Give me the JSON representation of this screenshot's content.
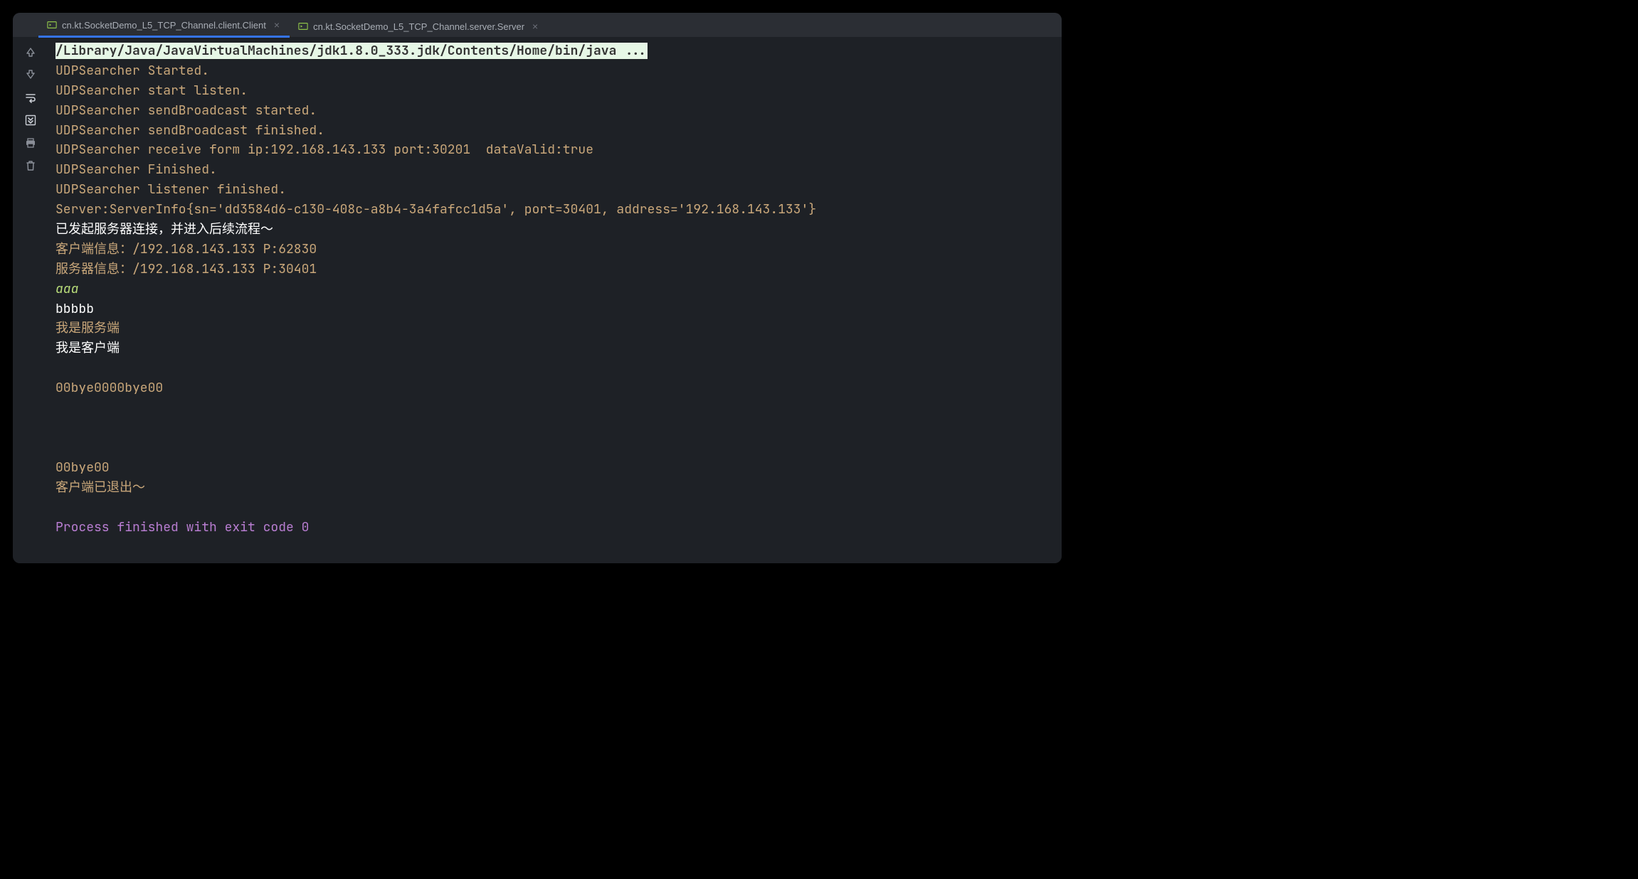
{
  "tabs": [
    {
      "label": "cn.kt.SocketDemo_L5_TCP_Channel.client.Client",
      "active": true
    },
    {
      "label": "cn.kt.SocketDemo_L5_TCP_Channel.server.Server",
      "active": false
    }
  ],
  "console": {
    "command": "/Library/Java/JavaVirtualMachines/jdk1.8.0_333.jdk/Contents/Home/bin/java ...",
    "lines": [
      {
        "type": "tan",
        "text": "UDPSearcher Started."
      },
      {
        "type": "tan",
        "text": "UDPSearcher start listen."
      },
      {
        "type": "tan",
        "text": "UDPSearcher sendBroadcast started."
      },
      {
        "type": "tan",
        "text": "UDPSearcher sendBroadcast finished."
      },
      {
        "type": "tan",
        "text": "UDPSearcher receive form ip:192.168.143.133 port:30201  dataValid:true"
      },
      {
        "type": "tan",
        "text": "UDPSearcher Finished."
      },
      {
        "type": "tan",
        "text": "UDPSearcher listener finished."
      },
      {
        "type": "tan",
        "text": "Server:ServerInfo{sn='dd3584d6-c130-408c-a8b4-3a4fafcc1d5a', port=30401, address='192.168.143.133'}"
      },
      {
        "type": "white",
        "text": "已发起服务器连接，并进入后续流程～"
      },
      {
        "type": "tan",
        "text": "客户端信息：/192.168.143.133 P:62830"
      },
      {
        "type": "tan",
        "text": "服务器信息：/192.168.143.133 P:30401"
      },
      {
        "type": "input",
        "text": "aaa"
      },
      {
        "type": "white",
        "text": "bbbbb"
      },
      {
        "type": "tan",
        "text": "我是服务端"
      },
      {
        "type": "white",
        "text": "我是客户端"
      },
      {
        "type": "blank",
        "text": ""
      },
      {
        "type": "tan",
        "text": "00bye0000bye00"
      },
      {
        "type": "blank",
        "text": ""
      },
      {
        "type": "blank",
        "text": ""
      },
      {
        "type": "blank",
        "text": ""
      },
      {
        "type": "tan",
        "text": "00bye00"
      },
      {
        "type": "tan",
        "text": "客户端已退出～"
      },
      {
        "type": "blank",
        "text": ""
      },
      {
        "type": "purple",
        "text": "Process finished with exit code 0"
      }
    ]
  }
}
